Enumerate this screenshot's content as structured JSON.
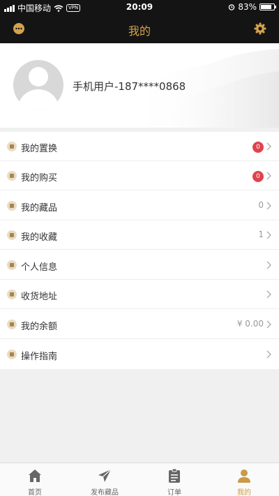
{
  "status_bar": {
    "carrier": "中国移动",
    "vpn": "VPN",
    "time": "20:09",
    "battery": "83%",
    "battery_level": 0.83
  },
  "header": {
    "title": "我的",
    "left_icon": "chat-bubble-icon",
    "right_icon": "gear-icon"
  },
  "profile": {
    "username": "手机用户-187****0868"
  },
  "menu": {
    "items": [
      {
        "label": "我的置换",
        "badge": "0",
        "value": "",
        "icon": "exchange-icon"
      },
      {
        "label": "我的购买",
        "badge": "0",
        "value": "",
        "icon": "cart-icon"
      },
      {
        "label": "我的藏品",
        "badge": "",
        "value": "0",
        "icon": "collection-icon"
      },
      {
        "label": "我的收藏",
        "badge": "",
        "value": "1",
        "icon": "heart-icon"
      },
      {
        "label": "个人信息",
        "badge": "",
        "value": "",
        "icon": "user-icon"
      },
      {
        "label": "收货地址",
        "badge": "",
        "value": "",
        "icon": "location-icon"
      },
      {
        "label": "我的余额",
        "badge": "",
        "value": "¥ 0.00",
        "icon": "wallet-icon"
      },
      {
        "label": "操作指南",
        "badge": "",
        "value": "",
        "icon": "help-icon"
      }
    ]
  },
  "tab_bar": {
    "tabs": [
      {
        "label": "首页",
        "icon": "home-icon",
        "active": false
      },
      {
        "label": "发布藏品",
        "icon": "paper-plane-icon",
        "active": false
      },
      {
        "label": "订单",
        "icon": "clipboard-icon",
        "active": false
      },
      {
        "label": "我的",
        "icon": "user-icon",
        "active": true
      }
    ]
  },
  "colors": {
    "accent": "#d4a24c",
    "header_bg": "#141414",
    "badge": "#e0434e"
  }
}
